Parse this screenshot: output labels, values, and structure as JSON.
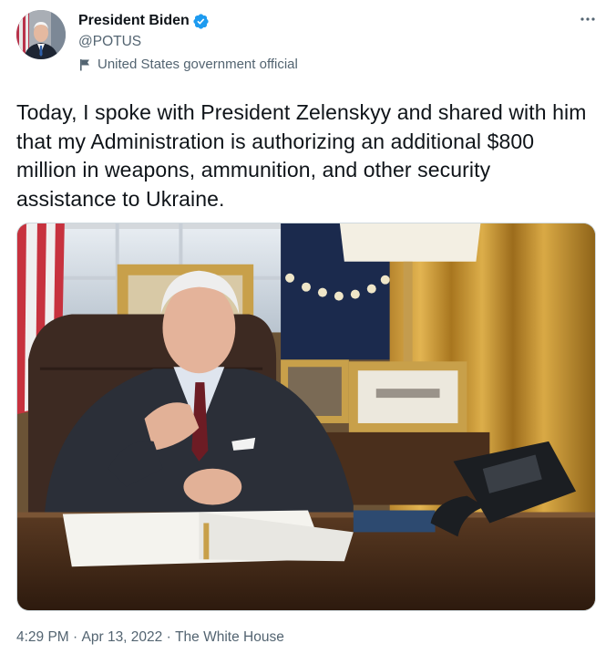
{
  "author": {
    "display_name": "President Biden",
    "handle": "@POTUS",
    "verified_icon": "verified-badge",
    "label": "United States government official"
  },
  "tweet": {
    "text": "Today, I spoke with President Zelenskyy and shared with him that my Administration is authorizing an additional $800 million in weapons, ammunition, and other security assistance to Ukraine."
  },
  "meta": {
    "time": "4:29 PM",
    "separator": " · ",
    "date": "Apr 13, 2022",
    "source": "The White House"
  },
  "colors": {
    "text": "#0f1419",
    "secondary": "#536471",
    "verified": "#1d9bf0"
  }
}
